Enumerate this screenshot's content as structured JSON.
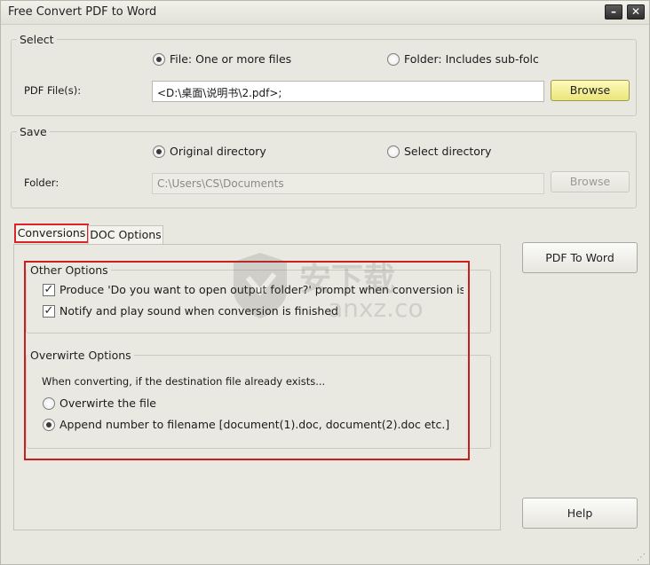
{
  "window": {
    "title": "Free Convert PDF to Word"
  },
  "select": {
    "legend": "Select",
    "file_radio_label": "File:  One or more files",
    "folder_radio_label": "Folder: Includes sub-folc",
    "pdf_label": "PDF File(s):",
    "pdf_value": "<D:\\桌面\\说明书\\2.pdf>;",
    "browse_label": "Browse",
    "selected": "file"
  },
  "save": {
    "legend": "Save",
    "original_label": "Original directory",
    "select_label": "Select directory",
    "folder_label": "Folder:",
    "folder_value": "C:\\Users\\CS\\Documents",
    "browse_label": "Browse",
    "selected": "original"
  },
  "tabs": [
    {
      "label": "Conversions",
      "active": true
    },
    {
      "label": "DOC Options",
      "active": false
    }
  ],
  "other_options": {
    "legend": "Other Options",
    "prompt_label": "Produce 'Do you want to open output folder?' prompt when conversion is finis",
    "prompt_checked": true,
    "notify_label": "Notify and play sound when conversion is finished",
    "notify_checked": true
  },
  "overwrite_options": {
    "legend": "Overwirte Options",
    "description": "When converting, if the destination file already exists...",
    "overwrite_label": "Overwirte the file",
    "append_label": "Append number to filename  [document(1).doc, document(2).doc etc.]",
    "selected": "append"
  },
  "actions": {
    "convert_label": "PDF To Word",
    "help_label": "Help"
  },
  "watermark": {
    "text_main": "安下载",
    "text_sub": "anxz.com"
  },
  "colors": {
    "highlight": "#c8201f",
    "browse_yellow": "#ece57a"
  }
}
